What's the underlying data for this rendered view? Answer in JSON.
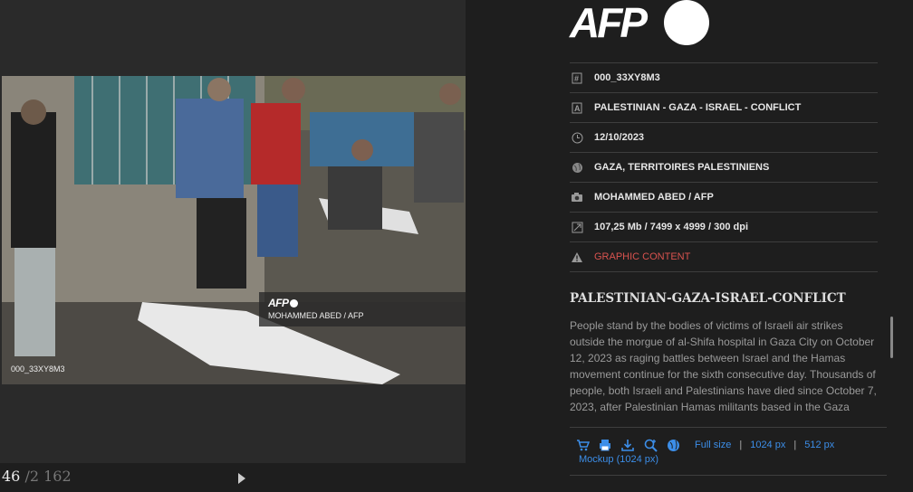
{
  "logo": {
    "text": "AFP"
  },
  "photo": {
    "credit_logo": "AFP",
    "credit": "MOHAMMED ABED / AFP",
    "id": "000_33XY8M3"
  },
  "pager": {
    "current": "46",
    "total": "/2 162"
  },
  "meta": [
    {
      "icon": "hash-icon",
      "text": "000_33XY8M3"
    },
    {
      "icon": "letter-a-icon",
      "text": "PALESTINIAN - GAZA - ISRAEL - CONFLICT"
    },
    {
      "icon": "clock-icon",
      "text": "12/10/2023"
    },
    {
      "icon": "globe-icon",
      "text": "GAZA, TERRITOIRES PALESTINIENS"
    },
    {
      "icon": "camera-icon",
      "text": "MOHAMMED ABED / AFP"
    },
    {
      "icon": "resize-icon",
      "text": "107,25 Mb / 7499 x 4999 / 300 dpi"
    },
    {
      "icon": "warning-icon",
      "text": "GRAPHIC CONTENT"
    }
  ],
  "caption": {
    "title": "PALESTINIAN-GAZA-ISRAEL-CONFLICT",
    "body": "People stand by the bodies of victims of Israeli air strikes outside the morgue of al-Shifa hospital in Gaza City on October 12, 2023 as raging battles between Israel and the Hamas movement continue for the sixth consecutive day. Thousands of people, both Israeli and Palestinians have died since October 7, 2023, after Palestinian Hamas militants based in the Gaza"
  },
  "actions": {
    "icons": [
      "cart-icon",
      "print-icon",
      "download-icon",
      "zoom-in-icon",
      "globe-icon"
    ],
    "full_size": "Full size",
    "size_1024": "1024 px",
    "size_512": "512 px",
    "mockup": "Mockup (1024 px)",
    "separator": "|"
  },
  "colors": {
    "accent": "#3c8ee8",
    "warning": "#d9534f",
    "background": "#1e1e1e"
  }
}
